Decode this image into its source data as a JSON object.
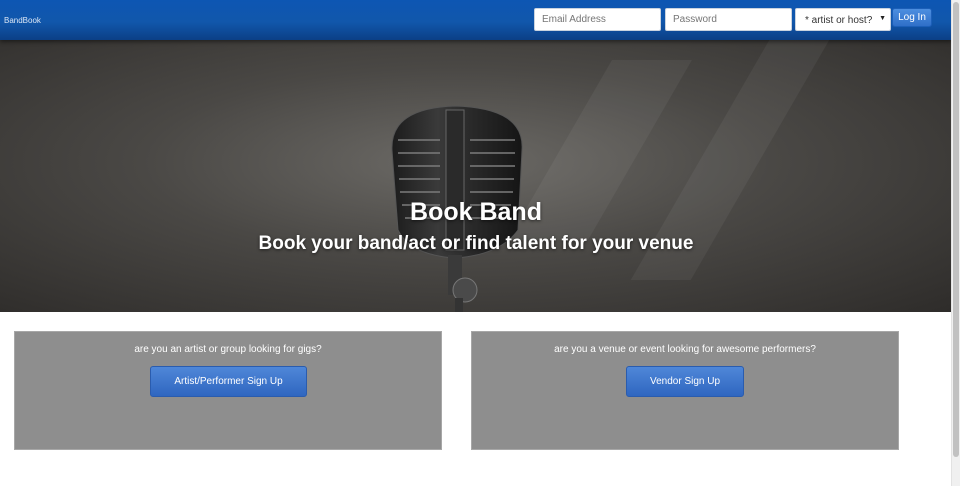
{
  "navbar": {
    "brand": "BandBook",
    "email_placeholder": "Email Address",
    "password_placeholder": "Password",
    "role_select": {
      "selected": "* artist or host?",
      "options": [
        "* artist or host?"
      ]
    },
    "login_label": "Log In"
  },
  "hero": {
    "title": "Book Band",
    "subtitle": "Book your band/act or find talent for your venue"
  },
  "cards": [
    {
      "question": "are you an artist or group looking for gigs?",
      "button_label": "Artist/Performer Sign Up"
    },
    {
      "question": "are you a venue or event looking for awesome performers?",
      "button_label": "Vendor Sign Up"
    }
  ],
  "colors": {
    "navbar": "#1157ab",
    "card_background": "#8e8e8e",
    "button": "#3a72cc"
  }
}
